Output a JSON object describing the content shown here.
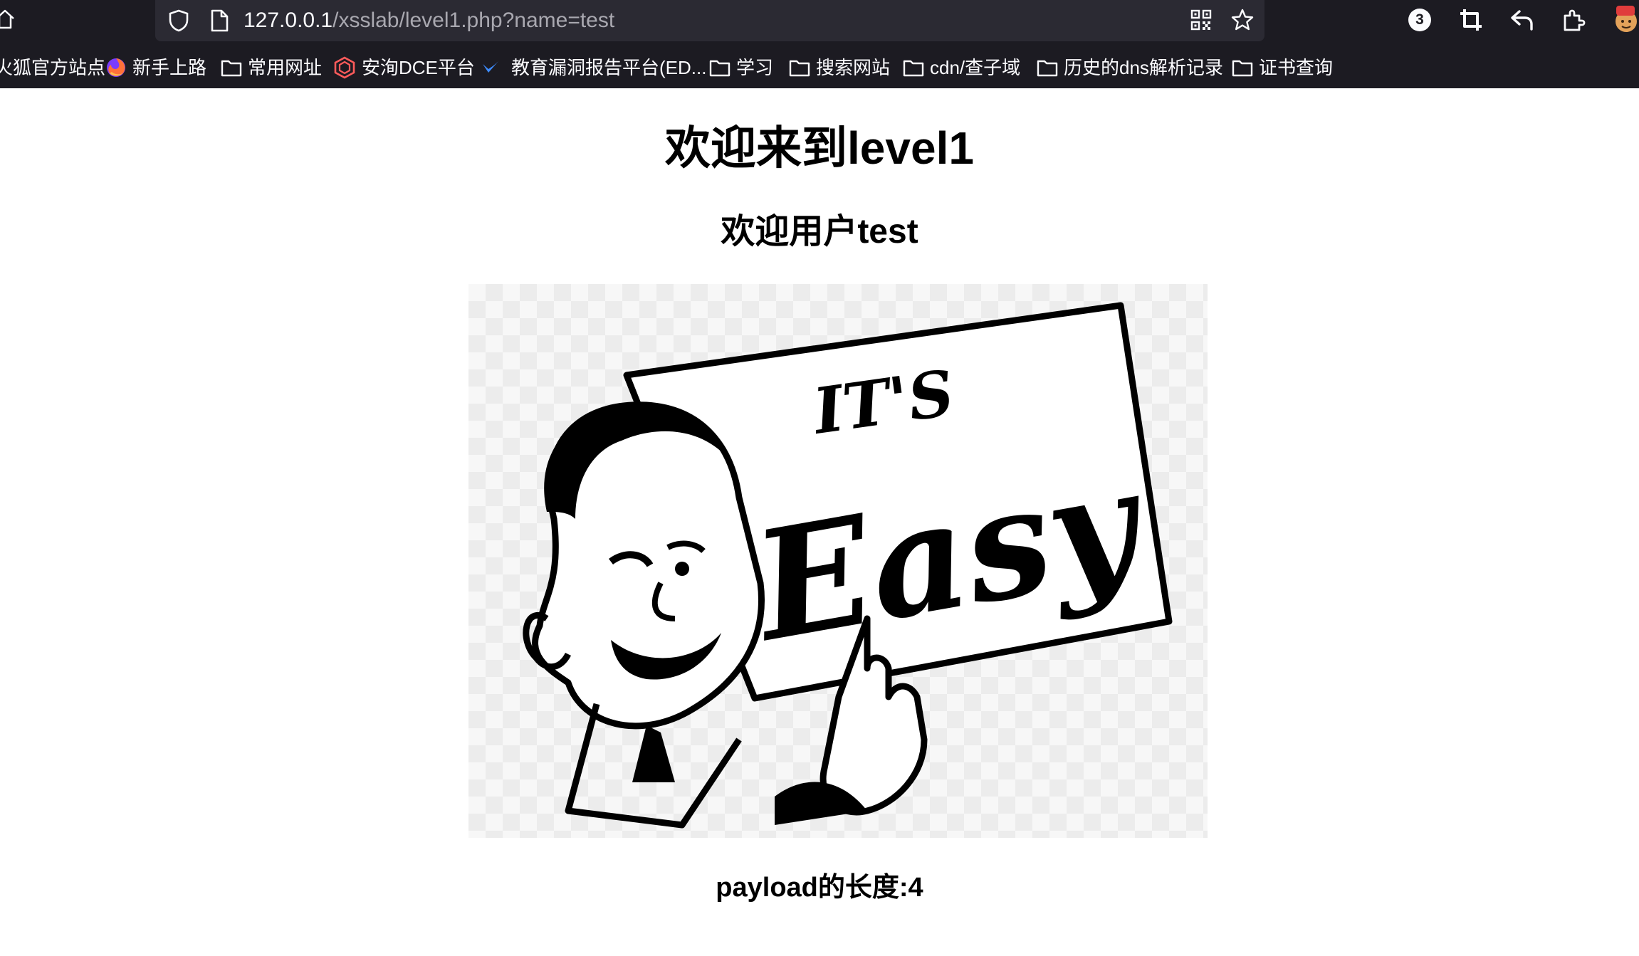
{
  "browser": {
    "url": {
      "host": "127.0.0.1",
      "path": "/xsslab/level1.php?name=test"
    },
    "toolbar": {
      "extensions_badge": "3"
    },
    "bookmarks": [
      {
        "label": "火狐官方站点",
        "icon": "firefox-icon"
      },
      {
        "label": "新手上路",
        "icon": "firefox-icon"
      },
      {
        "label": "常用网址",
        "icon": "folder-icon"
      },
      {
        "label": "安洵DCE平台",
        "icon": "dce-logo-icon"
      },
      {
        "label": "教育漏洞报告平台(ED...",
        "icon": "edu-src-icon"
      },
      {
        "label": "学习",
        "icon": "folder-icon"
      },
      {
        "label": "搜索网站",
        "icon": "folder-icon"
      },
      {
        "label": "cdn/查子域",
        "icon": "folder-icon"
      },
      {
        "label": "历史的dns解析记录",
        "icon": "folder-icon"
      },
      {
        "label": "证书查询",
        "icon": "folder-icon"
      }
    ]
  },
  "page": {
    "heading": "欢迎来到level1",
    "welcome": "欢迎用户test",
    "image_sign_text": "IT'S Easy",
    "payload_length": "payload的长度:4"
  },
  "colors": {
    "chrome_bg": "#1c1b22",
    "urlbar_bg": "#2b2a33",
    "chrome_text": "#fbfbfe",
    "url_path_text": "#a9a8b0",
    "page_bg": "#ffffff",
    "text": "#000000"
  }
}
